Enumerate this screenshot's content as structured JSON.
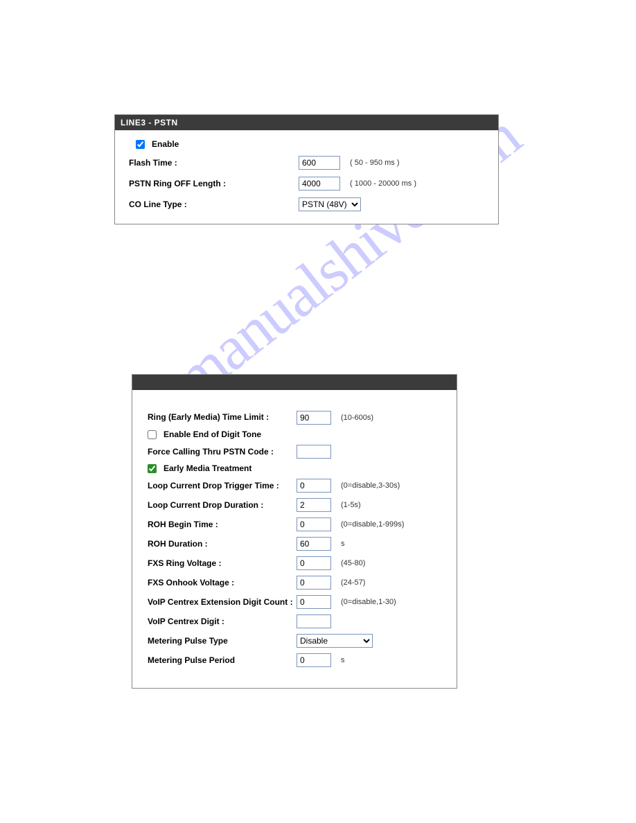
{
  "watermark": "manualshive.com",
  "panel1": {
    "title": "LINE3 - PSTN",
    "enable": {
      "label": "Enable",
      "checked": true
    },
    "flash_time": {
      "label": "Flash Time :",
      "value": "600",
      "hint": "( 50 - 950 ms )"
    },
    "ring_off": {
      "label": "PSTN Ring OFF Length :",
      "value": "4000",
      "hint": "( 1000 - 20000 ms )"
    },
    "co_line": {
      "label": "CO Line Type :",
      "value": "PSTN (48V)"
    }
  },
  "panel2": {
    "ring_limit": {
      "label": "Ring (Early Media) Time Limit :",
      "value": "90",
      "hint": "(10-600s)"
    },
    "eod_tone": {
      "label": "Enable End of Digit Tone",
      "checked": false
    },
    "force_pstn": {
      "label": "Force Calling Thru PSTN Code :",
      "value": ""
    },
    "early_media": {
      "label": "Early Media Treatment",
      "checked": true
    },
    "loop_trigger": {
      "label": "Loop Current Drop Trigger Time :",
      "value": "0",
      "hint": "(0=disable,3-30s)"
    },
    "loop_dur": {
      "label": "Loop Current Drop Duration :",
      "value": "2",
      "hint": "(1-5s)"
    },
    "roh_begin": {
      "label": "ROH Begin Time :",
      "value": "0",
      "hint": "(0=disable,1-999s)"
    },
    "roh_dur": {
      "label": "ROH Duration :",
      "value": "60",
      "hint": "s"
    },
    "fxs_ring_v": {
      "label": "FXS Ring Voltage :",
      "value": "0",
      "hint": "(45-80)"
    },
    "fxs_onhook_v": {
      "label": "FXS Onhook Voltage :",
      "value": "0",
      "hint": "(24-57)"
    },
    "centrex_cnt": {
      "label": "VoIP Centrex Extension Digit Count :",
      "value": "0",
      "hint": "(0=disable,1-30)"
    },
    "centrex_digit": {
      "label": "VoIP Centrex Digit :",
      "value": ""
    },
    "meter_type": {
      "label": "Metering Pulse Type",
      "value": "Disable"
    },
    "meter_period": {
      "label": "Metering Pulse Period",
      "value": "0",
      "hint": "s"
    }
  }
}
